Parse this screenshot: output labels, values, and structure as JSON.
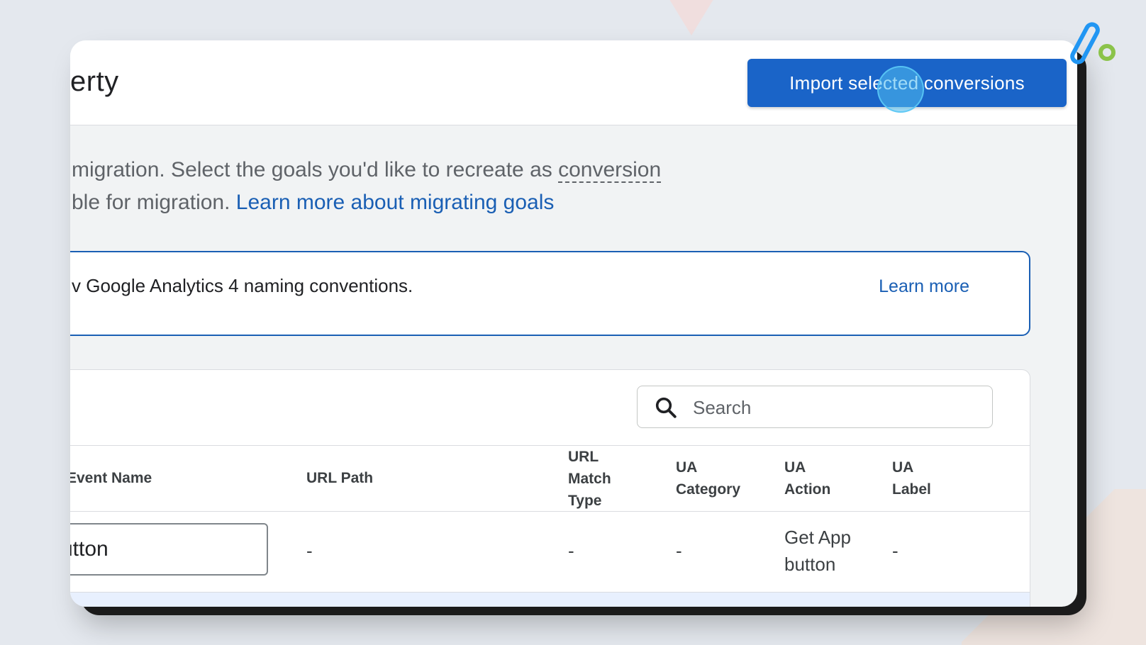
{
  "header": {
    "title": "erty",
    "import_button": "Import selected conversions"
  },
  "description": {
    "line1_text": "migration. Select the goals you'd like to recreate as ",
    "line1_term": "conversion",
    "line2_text": "ble for migration. ",
    "line2_link": "Learn more about migrating goals"
  },
  "banner": {
    "text": "v Google Analytics 4 naming conventions.",
    "link": "Learn more"
  },
  "search": {
    "placeholder": "Search",
    "icon": "search-icon"
  },
  "table": {
    "columns": [
      "Event Name",
      "URL Path",
      "URL\nMatch\nType",
      "UA\nCategory",
      "UA\nAction",
      "UA\nLabel"
    ],
    "rows": [
      {
        "event_name": "utton",
        "url_path": "-",
        "url_match_type": "-",
        "ua_category": "-",
        "ua_action": "Get App button",
        "ua_label": "-"
      }
    ]
  },
  "colors": {
    "primary": "#1a64c8",
    "link": "#1a5fb4",
    "logo_blue": "#2196f3",
    "logo_green": "#8bc34a"
  }
}
